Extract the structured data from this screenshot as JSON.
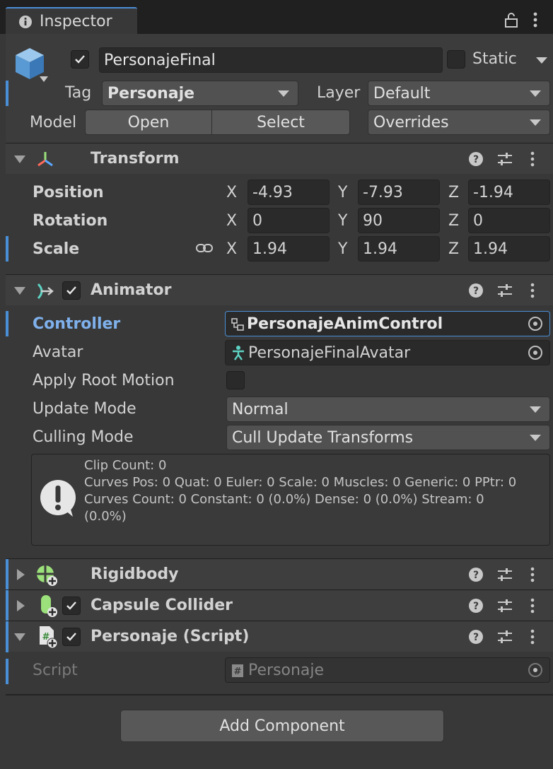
{
  "tab": {
    "title": "Inspector"
  },
  "object": {
    "name": "PersonajeFinal",
    "static_label": "Static",
    "tag_label": "Tag",
    "tag_value": "Personaje",
    "layer_label": "Layer",
    "layer_value": "Default",
    "model_label": "Model",
    "open_label": "Open",
    "select_label": "Select",
    "overrides_label": "Overrides"
  },
  "transform": {
    "title": "Transform",
    "rows": [
      {
        "label": "Position",
        "x": "-4.93",
        "y": "-7.93",
        "z": "-1.94"
      },
      {
        "label": "Rotation",
        "x": "0",
        "y": "90",
        "z": "0"
      },
      {
        "label": "Scale",
        "x": "1.94",
        "y": "1.94",
        "z": "1.94"
      }
    ],
    "axis_x": "X",
    "axis_y": "Y",
    "axis_z": "Z"
  },
  "animator": {
    "title": "Animator",
    "controller_label": "Controller",
    "controller_value": "PersonajeAnimControl",
    "avatar_label": "Avatar",
    "avatar_value": "PersonajeFinalAvatar",
    "apply_root_label": "Apply Root Motion",
    "update_mode_label": "Update Mode",
    "update_mode_value": "Normal",
    "culling_mode_label": "Culling Mode",
    "culling_mode_value": "Cull Update Transforms",
    "info_line1": "Clip Count: 0",
    "info_line2": "Curves Pos: 0 Quat: 0 Euler: 0 Scale: 0 Muscles: 0 Generic: 0 PPtr: 0",
    "info_line3": "Curves Count: 0 Constant: 0 (0.0%) Dense: 0 (0.0%) Stream: 0",
    "info_line4": "(0.0%)"
  },
  "rigidbody": {
    "title": "Rigidbody"
  },
  "capsule": {
    "title": "Capsule Collider"
  },
  "script": {
    "title": "Personaje (Script)",
    "script_label": "Script",
    "script_value": "Personaje"
  },
  "add_component_label": "Add Component",
  "colors": {
    "accent": "#4a8fd6",
    "controller_label": "#7fb1ec",
    "panel": "#383838",
    "header": "#3e3e3e"
  }
}
